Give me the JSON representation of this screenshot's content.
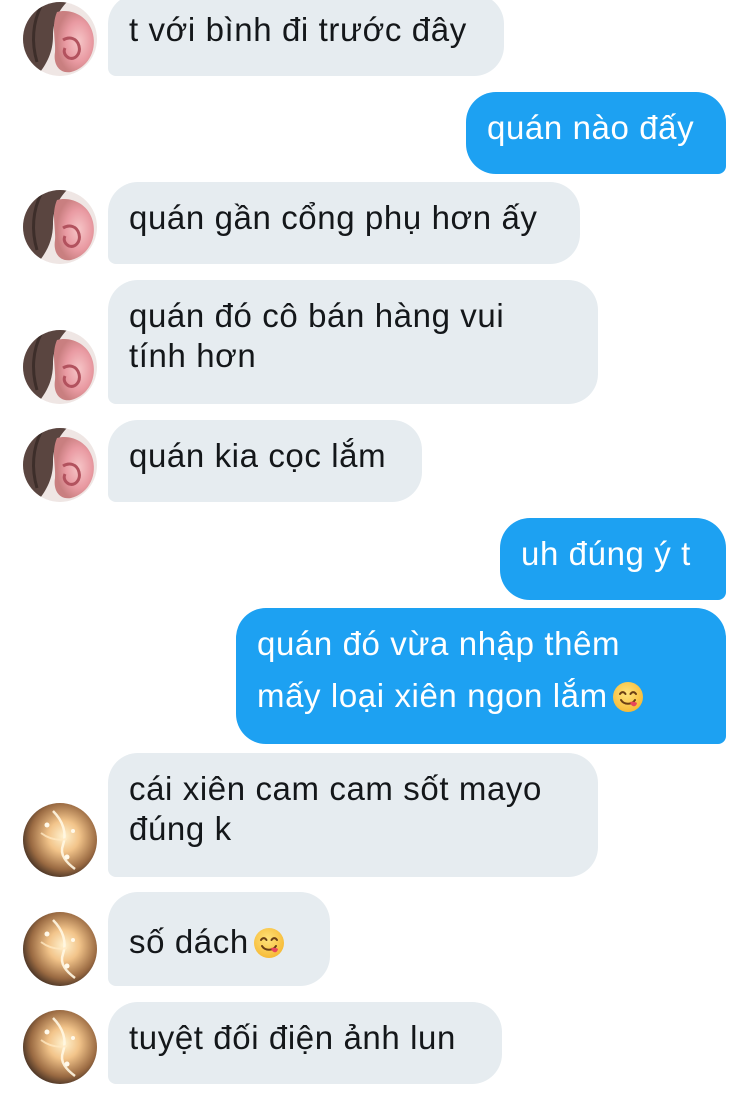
{
  "colors": {
    "incoming_bubble": "#e6ecf0",
    "outgoing_bubble": "#1da1f2",
    "incoming_text": "#14171a",
    "outgoing_text": "#ffffff",
    "background": "#ffffff"
  },
  "messages": [
    {
      "side": "incoming",
      "avatar": "contact-avatar-dark",
      "lines": [
        "t với bình đi trước đây"
      ]
    },
    {
      "side": "outgoing",
      "lines": [
        "quán nào đấy"
      ]
    },
    {
      "side": "incoming",
      "avatar": "contact-avatar-dark",
      "lines": [
        "quán gần cổng phụ hơn ấy"
      ]
    },
    {
      "side": "incoming",
      "avatar": "contact-avatar-dark",
      "lines": [
        "quán đó cô bán hàng vui",
        "tính hơn"
      ]
    },
    {
      "side": "incoming",
      "avatar": "contact-avatar-dark",
      "lines": [
        "quán kia cọc lắm"
      ]
    },
    {
      "side": "outgoing",
      "lines": [
        "uh đúng ý t"
      ]
    },
    {
      "side": "outgoing",
      "lines": [
        "quán đó vừa nhập thêm",
        "mấy loại xiên ngon lắm"
      ],
      "emoji": "savoring-face-emoji"
    },
    {
      "side": "incoming",
      "avatar": "contact-avatar-glow",
      "lines": [
        "cái xiên cam cam sốt mayo",
        "đúng k"
      ]
    },
    {
      "side": "incoming",
      "avatar": "contact-avatar-glow",
      "lines": [
        "số dách"
      ],
      "emoji": "savoring-face-emoji"
    },
    {
      "side": "incoming",
      "avatar": "contact-avatar-glow",
      "lines": [
        "tuyệt đối điện ảnh lun"
      ]
    }
  ]
}
